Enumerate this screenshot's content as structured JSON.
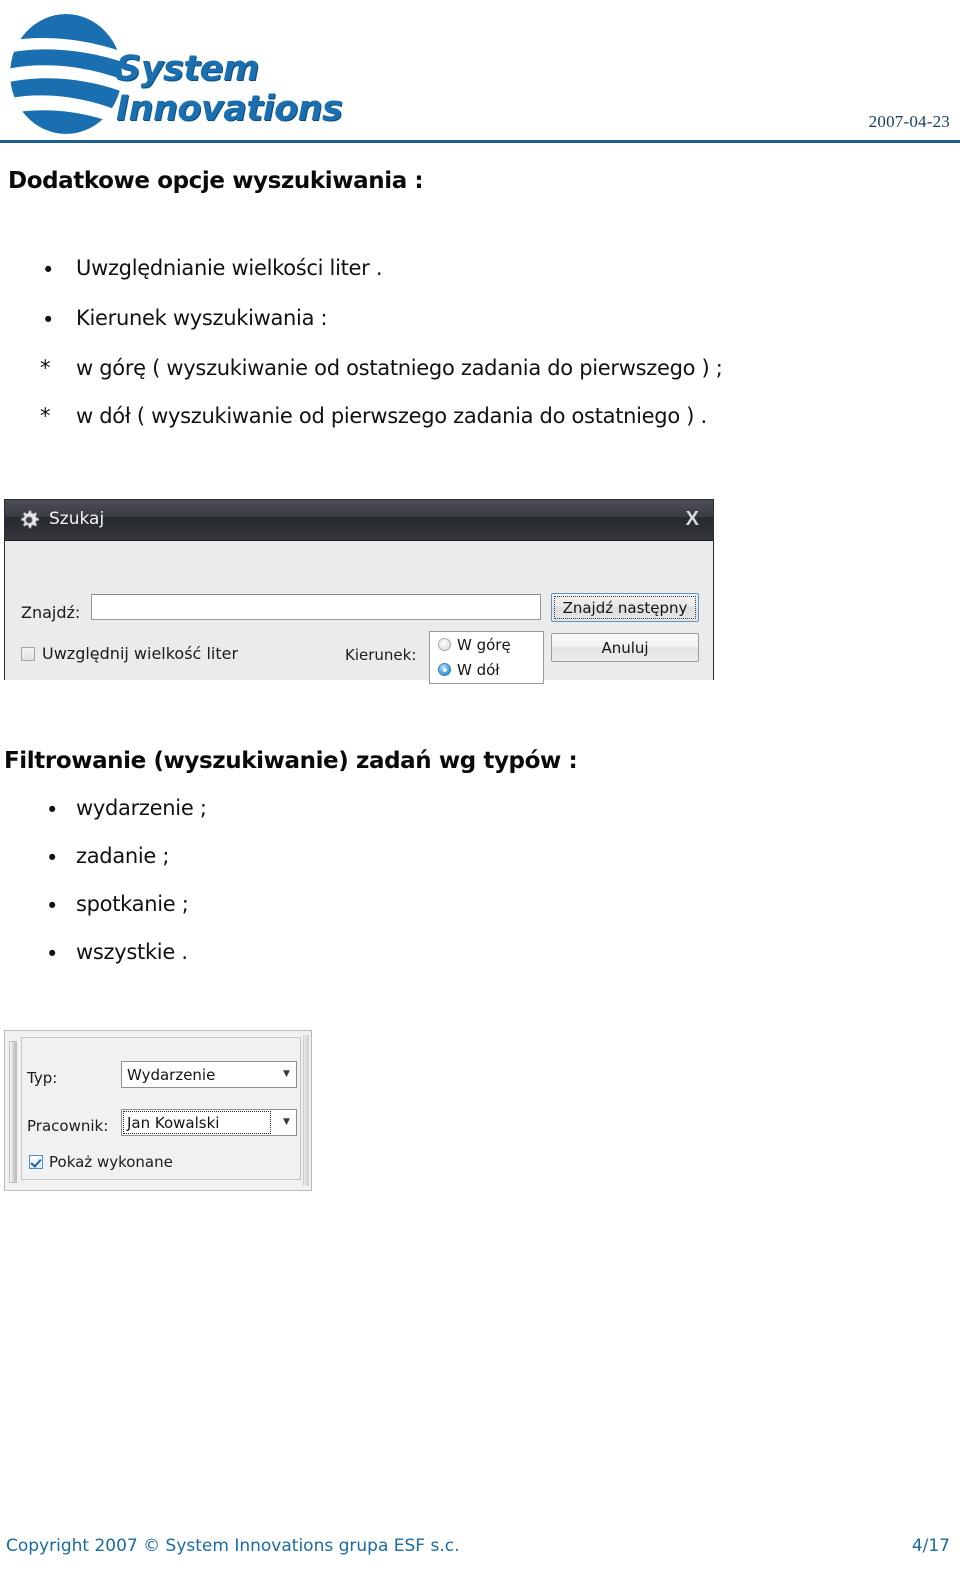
{
  "header": {
    "logo": {
      "line1": "System",
      "line2": "Innovations",
      "icon": "globe-swoosh-logo",
      "color": "#1a6fb0"
    },
    "date": "2007-04-23",
    "rule_color": "#1d5e91"
  },
  "content": {
    "section1": {
      "title": "Dodatkowe opcje wyszukiwania :",
      "bullets": [
        {
          "marker": "•",
          "text": "Uwzględnianie wielkości liter ."
        },
        {
          "marker": "•",
          "text": "Kierunek wyszukiwania :"
        },
        {
          "marker": "*",
          "text": "w górę ( wyszukiwanie od ostatniego zadania do pierwszego ) ;"
        },
        {
          "marker": "*",
          "text": "w dół ( wyszukiwanie od pierwszego zadania do ostatniego ) ."
        }
      ]
    },
    "section2": {
      "title": "Filtrowanie (wyszukiwanie) zadań wg typów :",
      "bullets": [
        {
          "marker": "•",
          "text": "wydarzenie ;"
        },
        {
          "marker": "•",
          "text": "zadanie ;"
        },
        {
          "marker": "•",
          "text": "spotkanie ;"
        },
        {
          "marker": "•",
          "text": "wszystkie ."
        }
      ]
    }
  },
  "search_dialog": {
    "title": "Szukaj",
    "title_icon": "gear-icon",
    "close_label": "X",
    "find_label": "Znajdź:",
    "find_value": "",
    "find_placeholder": "",
    "case_checkbox": {
      "label": "Uwzględnij wielkość liter",
      "checked": false
    },
    "direction_label": "Kierunek:",
    "direction_options": [
      {
        "label": "W górę",
        "selected": false
      },
      {
        "label": "W dół",
        "selected": true
      }
    ],
    "buttons": {
      "find_next": "Znajdź następny",
      "cancel": "Anuluj"
    }
  },
  "filter_panel": {
    "type_label": "Typ:",
    "type_value": "Wydarzenie",
    "employee_label": "Pracownik:",
    "employee_value": "Jan Kowalski",
    "show_done_checkbox": {
      "label": "Pokaż wykonane",
      "checked": true
    },
    "arrow_glyph": "▼"
  },
  "footer": {
    "copyright": "Copyright 2007 © System Innovations grupa ESF s.c.",
    "page": "4/17",
    "color": "#1a6ba4"
  }
}
